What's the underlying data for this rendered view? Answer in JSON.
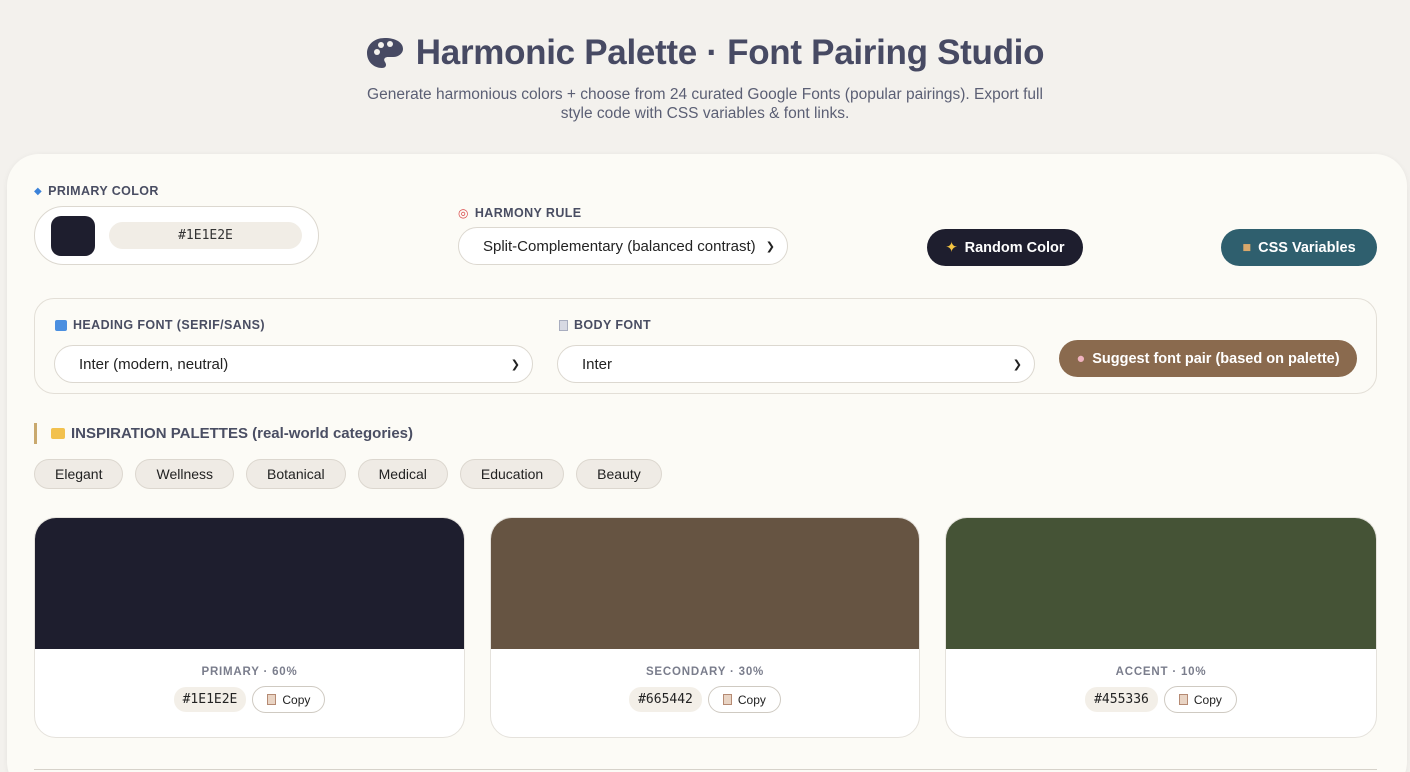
{
  "header": {
    "title": "Harmonic Palette · Font Pairing Studio",
    "subtitle": "Generate harmonious colors + choose from 24 curated Google Fonts (popular pairings). Export full style code with CSS variables & font links."
  },
  "primary": {
    "label": "PRIMARY COLOR",
    "icon": "diamond-icon",
    "value": "#1E1E2E",
    "swatch": "#1e1e2e"
  },
  "harmony": {
    "label": "HARMONY RULE",
    "icon": "target-icon",
    "selected": "Split-Complementary (balanced contrast)"
  },
  "buttons": {
    "random": {
      "label": "Random Color",
      "icon": "sparkles-icon",
      "color": "#1e1e2e"
    },
    "css": {
      "label": "CSS Variables",
      "icon": "package-icon",
      "color": "#2f5f6e"
    },
    "suggest": {
      "label": "Suggest font pair (based on palette)",
      "icon": "palette-icon",
      "color": "#8a6a4e"
    }
  },
  "fonts": {
    "heading": {
      "label": "HEADING FONT (SERIF/SANS)",
      "icon": "abc-icon",
      "selected": "Inter (modern, neutral)"
    },
    "body": {
      "label": "BODY FONT",
      "icon": "document-icon",
      "selected": "Inter"
    }
  },
  "inspiration": {
    "title": "INSPIRATION PALETTES (real-world categories)",
    "icon": "folder-icon",
    "categories": [
      "Elegant",
      "Wellness",
      "Botanical",
      "Medical",
      "Education",
      "Beauty"
    ]
  },
  "palette": [
    {
      "role": "PRIMARY · 60%",
      "hex": "#1E1E2E",
      "color": "#1e1e2e",
      "copy_label": "Copy"
    },
    {
      "role": "SECONDARY · 30%",
      "hex": "#665442",
      "color": "#665442",
      "copy_label": "Copy"
    },
    {
      "role": "ACCENT · 10%",
      "hex": "#455336",
      "color": "#455336",
      "copy_label": "Copy"
    }
  ]
}
